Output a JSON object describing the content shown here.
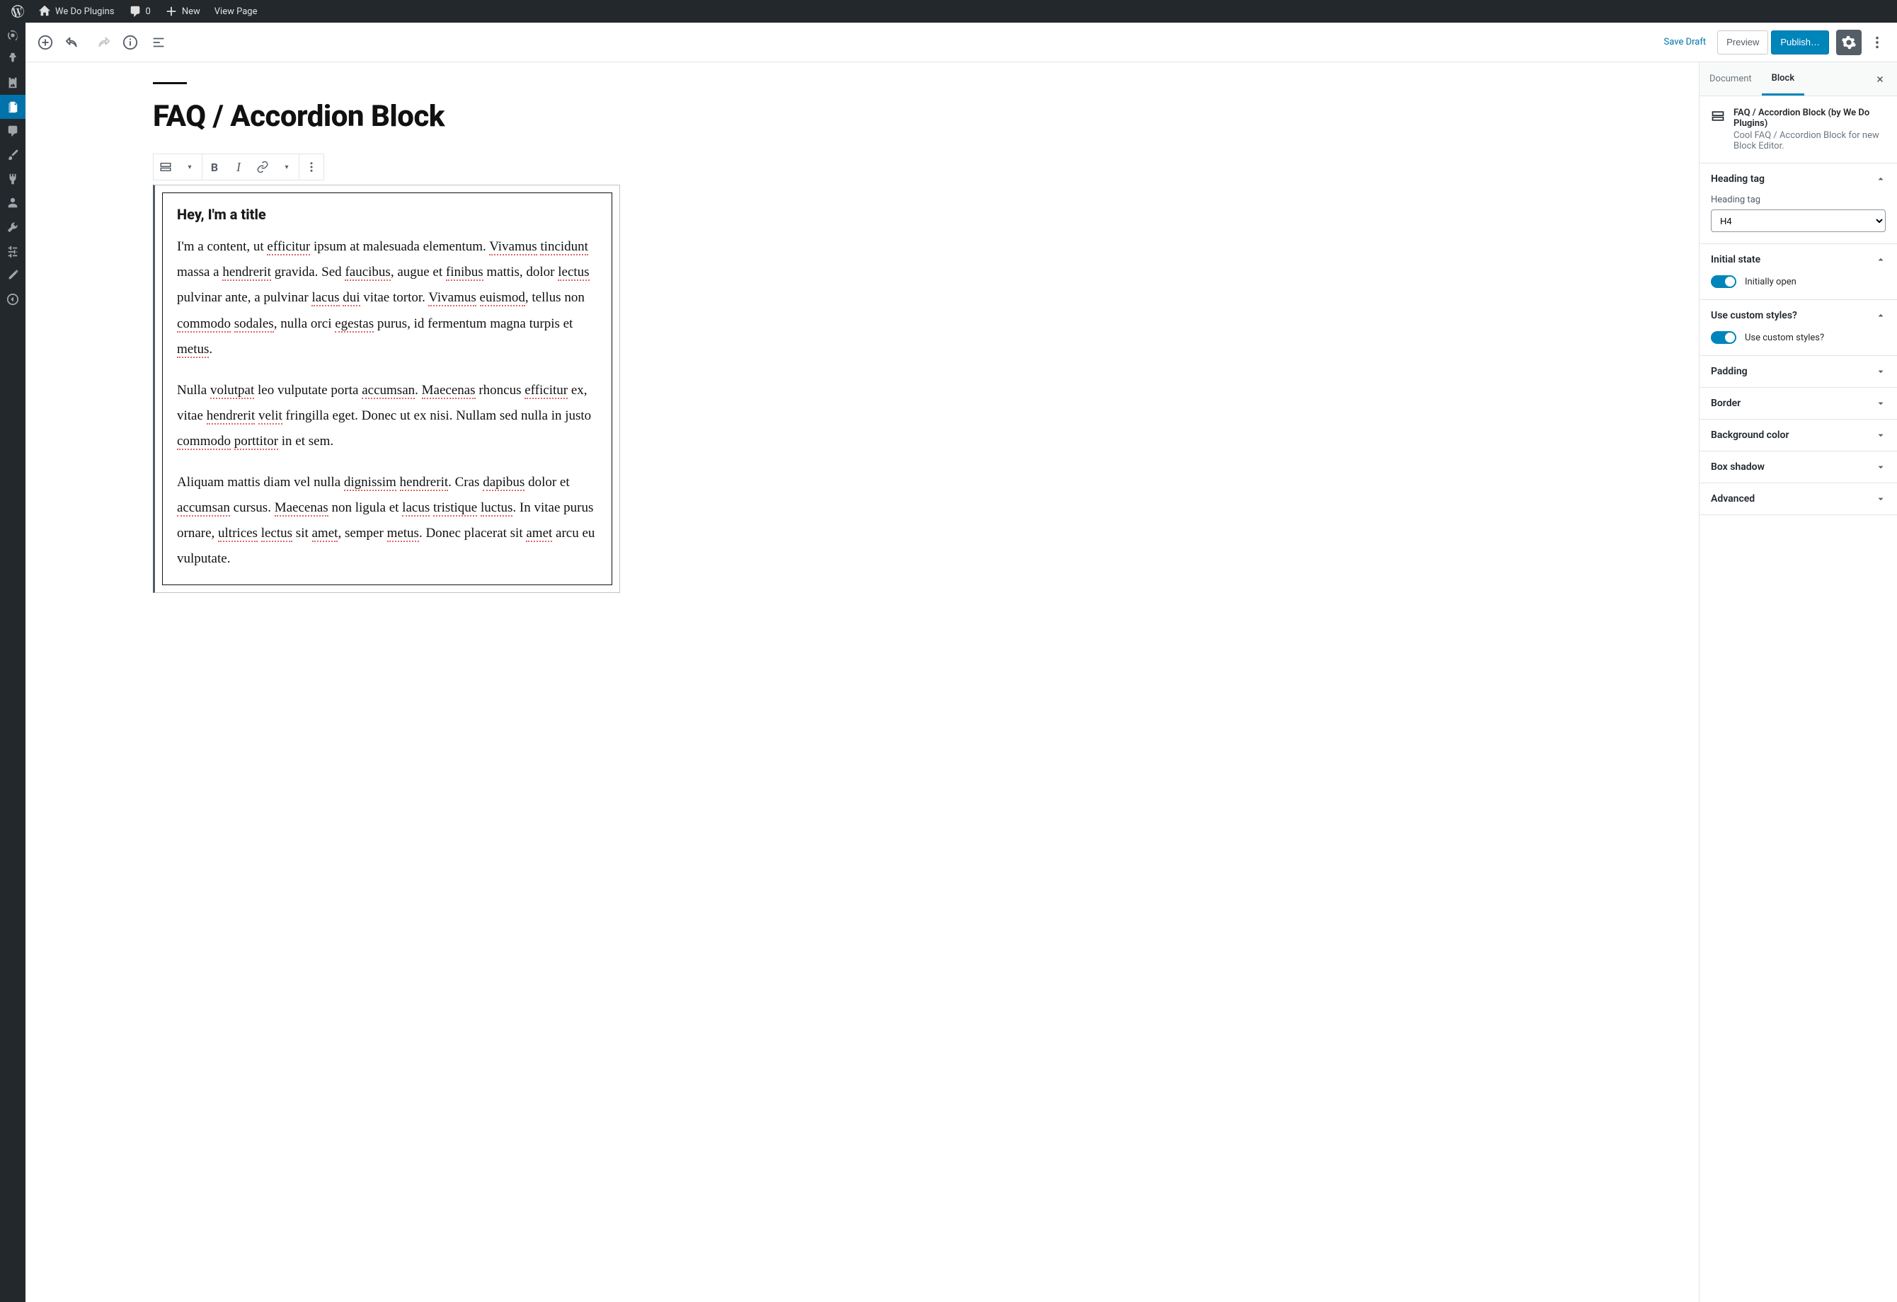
{
  "adminbar": {
    "site_name": "We Do Plugins",
    "comments_count": "0",
    "new_label": "New",
    "view_page_label": "View Page"
  },
  "header": {
    "save_draft": "Save Draft",
    "preview": "Preview",
    "publish": "Publish…"
  },
  "post": {
    "title": "FAQ / Accordion Block"
  },
  "accordion": {
    "heading": "Hey, I'm a title",
    "paragraph1_plain": "I'm a content, ut efficitur ipsum at malesuada elementum. Vivamus tincidunt massa a hendrerit gravida. Sed faucibus, augue et finibus mattis, dolor lectus pulvinar ante, a pulvinar lacus dui vitae tortor. Vivamus euismod, tellus non commodo sodales, nulla orci egestas purus, id fermentum magna turpis et metus.",
    "paragraph2_plain": "Nulla volutpat leo vulputate porta accumsan. Maecenas rhoncus efficitur ex, vitae hendrerit velit fringilla eget. Donec ut ex nisi. Nullam sed nulla in justo commodo porttitor in et sem.",
    "paragraph3_plain": "Aliquam mattis diam vel nulla dignissim hendrerit. Cras dapibus dolor et accumsan cursus. Maecenas non ligula et lacus tristique luctus. In vitae purus ornare, ultrices lectus sit amet, semper metus. Donec placerat sit amet arcu eu vulputate."
  },
  "sidebar": {
    "tabs": {
      "document": "Document",
      "block": "Block"
    },
    "block_info": {
      "title": "FAQ / Accordion Block (by We Do Plugins)",
      "description": "Cool FAQ / Accordion Block for new Block Editor."
    },
    "panels": {
      "heading_tag": {
        "title": "Heading tag",
        "label": "Heading tag",
        "value": "H4"
      },
      "initial_state": {
        "title": "Initial state",
        "toggle_label": "Initially open",
        "on": true
      },
      "custom_styles": {
        "title": "Use custom styles?",
        "toggle_label": "Use custom styles?",
        "on": true
      },
      "padding": {
        "title": "Padding"
      },
      "border": {
        "title": "Border"
      },
      "background": {
        "title": "Background color"
      },
      "box_shadow": {
        "title": "Box shadow"
      },
      "advanced": {
        "title": "Advanced"
      }
    }
  }
}
